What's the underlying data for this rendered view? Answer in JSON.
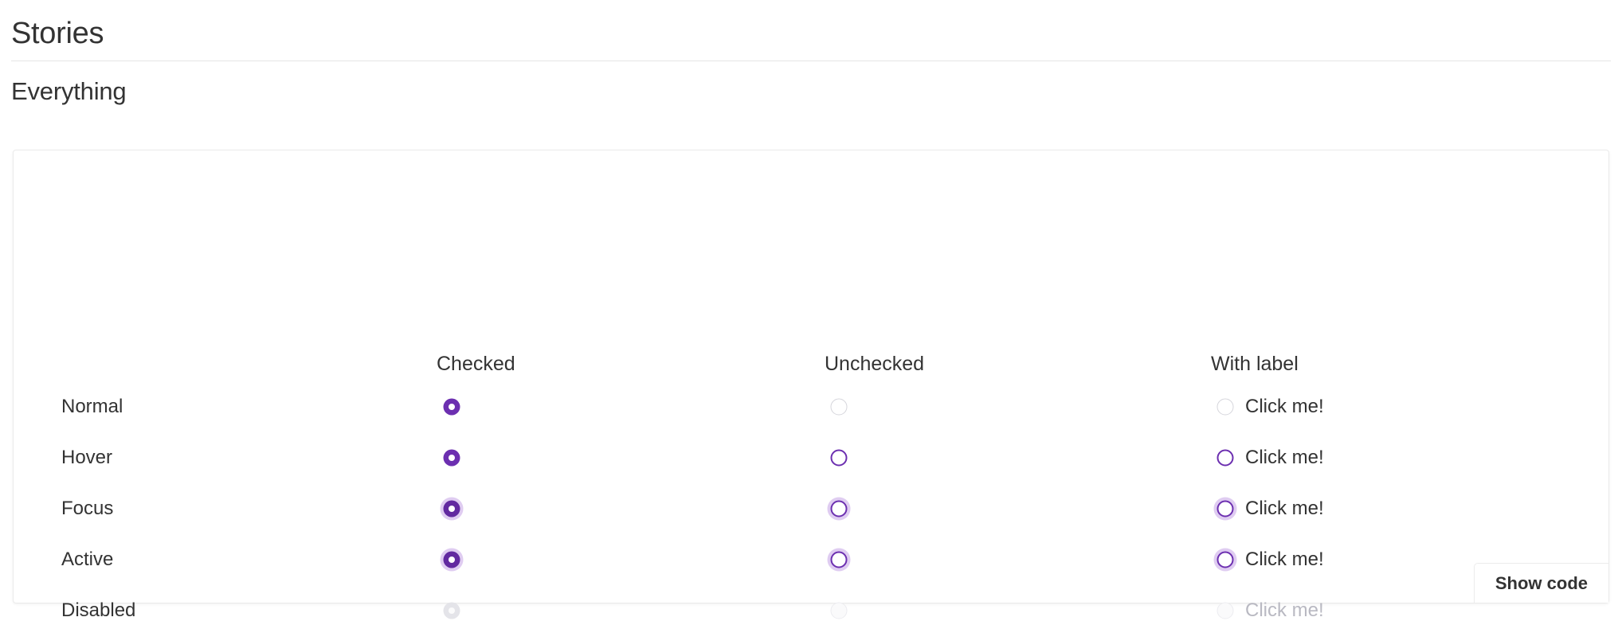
{
  "header": {
    "title": "Stories",
    "subtitle": "Everything"
  },
  "card": {
    "columns": [
      {
        "key": "checked",
        "label": "Checked"
      },
      {
        "key": "unchecked",
        "label": "Unchecked"
      },
      {
        "key": "withlabel",
        "label": "With label"
      }
    ],
    "rows": [
      {
        "state": "normal",
        "label": "Normal",
        "label_text": "Click me!"
      },
      {
        "state": "hover",
        "label": "Hover",
        "label_text": "Click me!"
      },
      {
        "state": "focus",
        "label": "Focus",
        "label_text": "Click me!"
      },
      {
        "state": "active",
        "label": "Active",
        "label_text": "Click me!"
      },
      {
        "state": "disabled",
        "label": "Disabled",
        "label_text": "Click me!"
      }
    ],
    "show_code_label": "Show code"
  },
  "colors": {
    "accent_purple": "#6C2FB0",
    "accent_purple_dark": "#6229A0",
    "focus_halo": "rgba(148,86,208,0.30)",
    "ring_gray": "#D6D6DC",
    "disabled_gray": "#E4E4E9",
    "disabled_text": "#B9B9C2",
    "text": "#333333",
    "card_border": "#EBEBEB",
    "divider": "#E6E6E6"
  }
}
